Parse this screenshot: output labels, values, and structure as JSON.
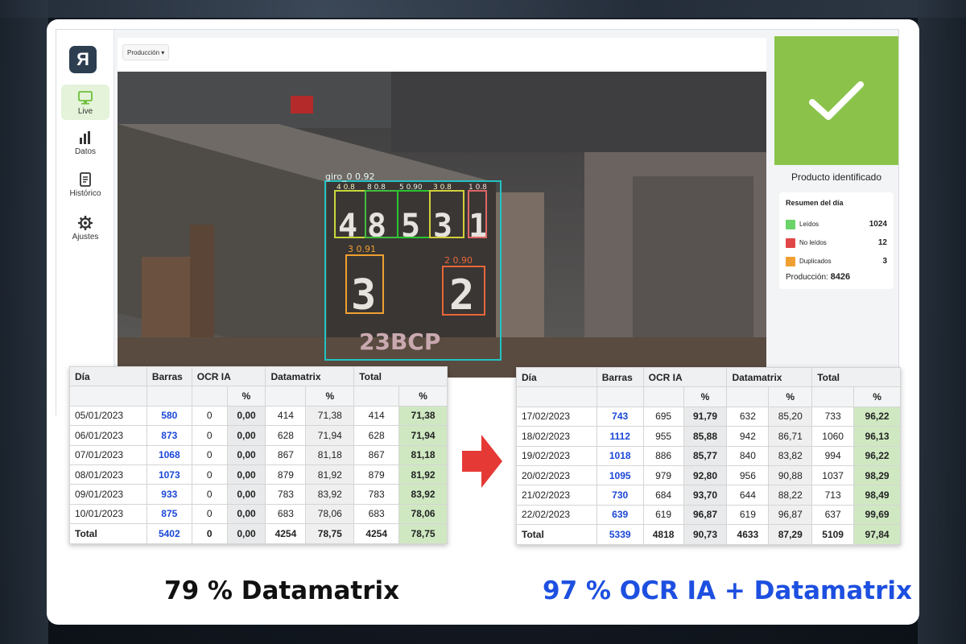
{
  "app": {
    "logo": "Я",
    "nav": [
      {
        "label": "Live",
        "icon": "monitor-icon",
        "active": true
      },
      {
        "label": "Datos",
        "icon": "bar-chart-icon",
        "active": false
      },
      {
        "label": "Histórico",
        "icon": "document-icon",
        "active": false
      },
      {
        "label": "Ajustes",
        "icon": "gear-icon",
        "active": false
      }
    ],
    "dropdown": "Producción ▾",
    "detections": {
      "giro": "giro_0 0.92",
      "digits_top": [
        "4 0.8",
        "8 0.8",
        "5 0.90",
        "3 0.8",
        "1 0.8"
      ],
      "digit_3": "3 0.91",
      "digit_2": "2 0.90",
      "stamp_text": "23BCP"
    },
    "status": {
      "caption": "Producto identificado",
      "accent": "#8bc34a"
    },
    "summary": {
      "title": "Resumen del día",
      "rows": [
        {
          "label": "Leídos",
          "value": "1024",
          "color": "#6ad36a"
        },
        {
          "label": "No leídos",
          "value": "12",
          "color": "#e04848"
        },
        {
          "label": "Duplicados",
          "value": "3",
          "color": "#f0a030"
        }
      ],
      "production_label": "Producción:",
      "production_value": "8426"
    }
  },
  "tables": {
    "headers": [
      "Día",
      "Barras",
      "OCR IA",
      "Datamatrix",
      "Total"
    ],
    "pct": "%",
    "left": {
      "rows": [
        [
          "05/01/2023",
          "580",
          "0",
          "0,00",
          "414",
          "71,38",
          "414",
          "71,38"
        ],
        [
          "06/01/2023",
          "873",
          "0",
          "0,00",
          "628",
          "71,94",
          "628",
          "71,94"
        ],
        [
          "07/01/2023",
          "1068",
          "0",
          "0,00",
          "867",
          "81,18",
          "867",
          "81,18"
        ],
        [
          "08/01/2023",
          "1073",
          "0",
          "0,00",
          "879",
          "81,92",
          "879",
          "81,92"
        ],
        [
          "09/01/2023",
          "933",
          "0",
          "0,00",
          "783",
          "83,92",
          "783",
          "83,92"
        ],
        [
          "10/01/2023",
          "875",
          "0",
          "0,00",
          "683",
          "78,06",
          "683",
          "78,06"
        ]
      ],
      "total": [
        "Total",
        "5402",
        "0",
        "0,00",
        "4254",
        "78,75",
        "4254",
        "78,75"
      ]
    },
    "right": {
      "rows": [
        [
          "17/02/2023",
          "743",
          "695",
          "91,79",
          "632",
          "85,20",
          "733",
          "96,22"
        ],
        [
          "18/02/2023",
          "1112",
          "955",
          "85,88",
          "942",
          "86,71",
          "1060",
          "96,13"
        ],
        [
          "19/02/2023",
          "1018",
          "886",
          "85,77",
          "840",
          "83,82",
          "994",
          "96,22"
        ],
        [
          "20/02/2023",
          "1095",
          "979",
          "92,80",
          "956",
          "90,88",
          "1037",
          "98,29"
        ],
        [
          "21/02/2023",
          "730",
          "684",
          "93,70",
          "644",
          "88,22",
          "713",
          "98,49"
        ],
        [
          "22/02/2023",
          "639",
          "619",
          "96,87",
          "619",
          "96,87",
          "637",
          "99,69"
        ]
      ],
      "total": [
        "Total",
        "5339",
        "4818",
        "90,73",
        "4633",
        "87,29",
        "5109",
        "97,84"
      ]
    }
  },
  "captions": {
    "left": "79 % Datamatrix",
    "right": "97 % OCR IA + Datamatrix",
    "right_color": "#1d4fe0"
  }
}
